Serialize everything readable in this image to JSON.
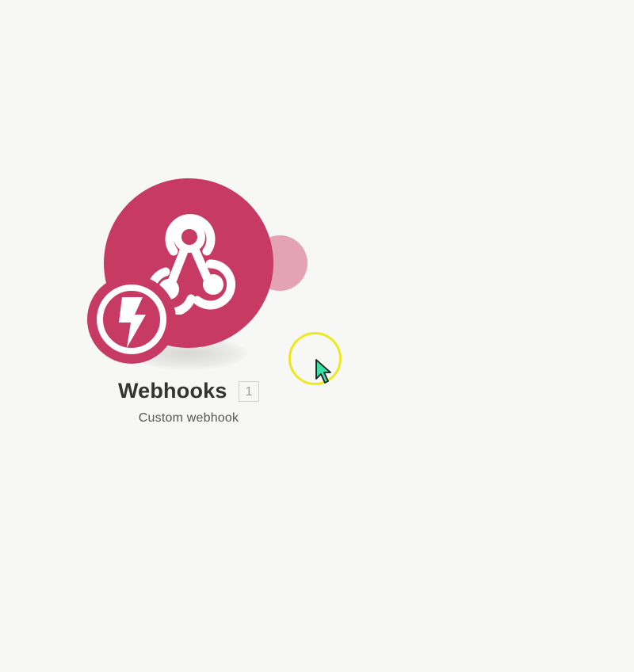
{
  "colors": {
    "background": "#f7f7f5",
    "module_accent": "#c73a63",
    "connector_tab": "#e4a2b5",
    "cursor_highlight": "#ede81f",
    "cursor_fill": "#35dfa6"
  },
  "module": {
    "icon": "webhook-icon",
    "badge_icon": "lightning-bolt-icon",
    "title": "Webhooks",
    "id": "1",
    "subtitle": "Custom webhook"
  },
  "cursor": {
    "icon": "mouse-pointer-icon"
  }
}
